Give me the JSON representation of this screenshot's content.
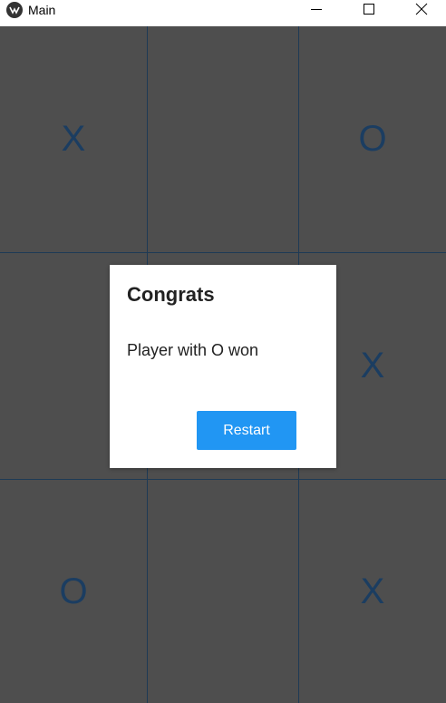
{
  "window": {
    "title": "Main",
    "controls": {
      "minimize_icon": "minimize-icon",
      "maximize_icon": "maximize-icon",
      "close_icon": "close-icon"
    }
  },
  "board": {
    "cells": [
      [
        "X",
        "",
        "O"
      ],
      [
        "",
        "",
        "X"
      ],
      [
        "O",
        "",
        "X"
      ]
    ],
    "colors": {
      "background": "#4e4e4e",
      "grid_line": "#1e3a55",
      "mark": "#1b3d61"
    }
  },
  "dialog": {
    "title": "Congrats",
    "message": "Player with O won",
    "restart_label": "Restart",
    "button_color": "#2196f3"
  }
}
